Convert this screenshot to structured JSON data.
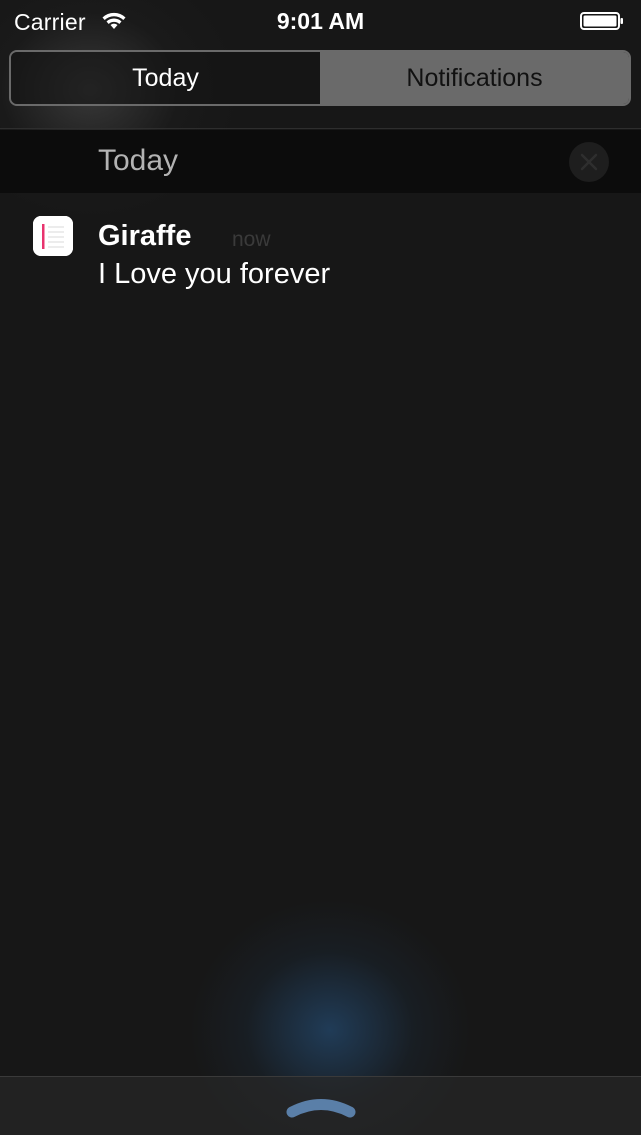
{
  "status_bar": {
    "carrier": "Carrier",
    "time": "9:01 AM"
  },
  "tabs": [
    {
      "label": "Today",
      "selected": true
    },
    {
      "label": "Notifications",
      "selected": false
    }
  ],
  "section": {
    "title": "Today"
  },
  "notification": {
    "app_name": "Giraffe",
    "time": "now",
    "message": "I Love you forever"
  },
  "icons": {
    "wifi": "wifi-icon",
    "battery": "battery-icon",
    "clear": "close-icon",
    "app": "notes-app-icon",
    "grabber": "chevron-up-icon"
  },
  "colors": {
    "background": "#171717",
    "header_bg": "#0c0c0c",
    "accent_pink": "#e8336e",
    "segment_unselected": "#6a6a6a",
    "grabber": "#5a7fa8"
  }
}
